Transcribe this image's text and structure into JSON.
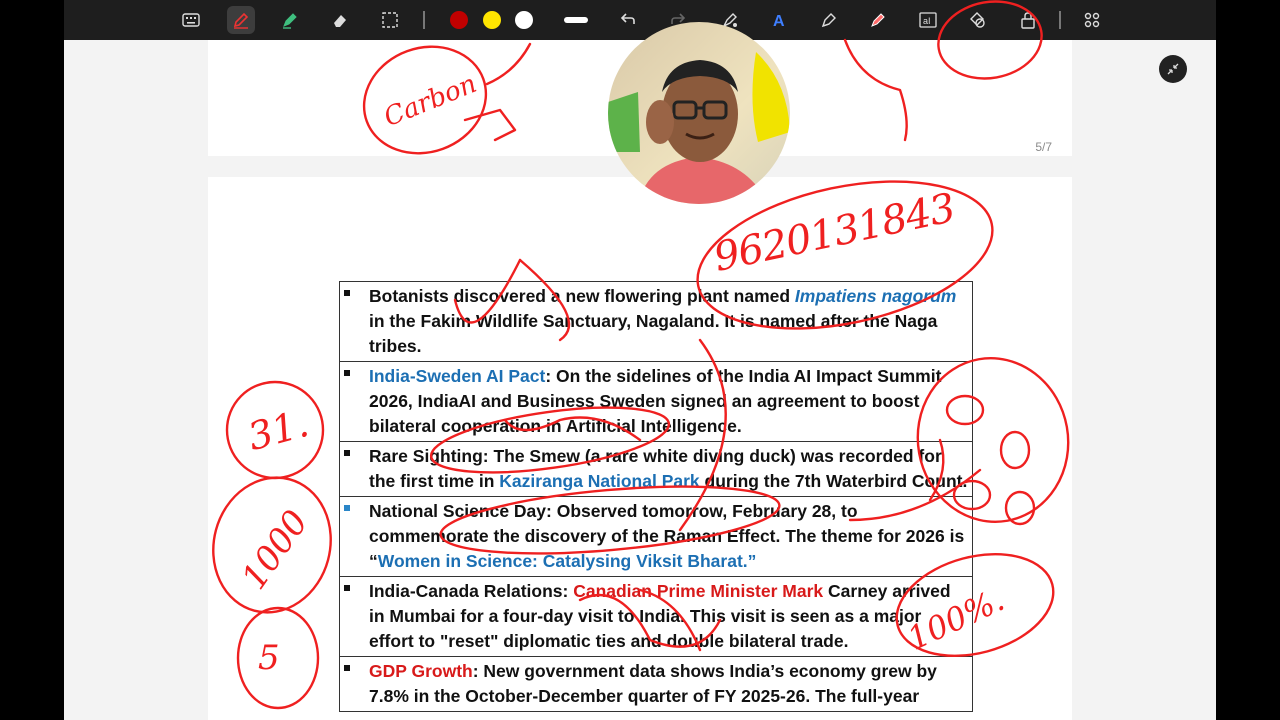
{
  "page_counter": "5/7",
  "toolbar": {
    "icons": [
      "keyboard-icon",
      "pen-icon",
      "highlighter-icon",
      "eraser-icon",
      "lasso-select-icon",
      "undo-icon",
      "redo-icon",
      "laser-pointer-icon",
      "text-icon",
      "shape-pen-icon",
      "red-pen-icon",
      "text-box-icon",
      "shapes-icon",
      "lock-icon",
      "grid-icon"
    ],
    "colors": {
      "red": "#c00000",
      "yellow": "#ffe500",
      "white": "#ffffff"
    }
  },
  "news": [
    {
      "parts": [
        {
          "t": "Botanists discovered a new flowering plant named ",
          "s": "n"
        },
        {
          "t": "Impatiens nagorum",
          "s": "bi"
        },
        {
          "t": " in the Fakim Wildlife Sanctuary, Nagaland. It is named after the Naga tribes.",
          "s": "n"
        }
      ]
    },
    {
      "parts": [
        {
          "t": "India-Sweden AI Pact",
          "s": "b"
        },
        {
          "t": ": On the sidelines of the India AI Impact Summit 2026, IndiaAI and Business Sweden signed an agreement to boost bilateral cooperation in Artificial Intelligence.",
          "s": "n"
        }
      ]
    },
    {
      "parts": [
        {
          "t": "Rare Sighting: The Smew (a rare white diving duck) was recorded for the first time in ",
          "s": "n"
        },
        {
          "t": "Kaziranga National Park",
          "s": "b"
        },
        {
          "t": " during the 7th Waterbird Count.",
          "s": "n"
        }
      ]
    },
    {
      "parts": [
        {
          "t": "National Science Day: Observed tomorrow, February 28, to commemorate the discovery of the Raman Effect. The theme for 2026 is “",
          "s": "n"
        },
        {
          "t": "Women in Science: Catalysing Viksit Bharat.”",
          "s": "b"
        }
      ]
    },
    {
      "parts": [
        {
          "t": " India-Canada Relations: ",
          "s": "n"
        },
        {
          "t": "Canadian Prime Minister Mark",
          "s": "r"
        },
        {
          "t": " Carney arrived in Mumbai for a four-day visit to India. This visit is seen as a major effort to \"reset\" diplomatic ties and double bilateral trade.",
          "s": "n"
        }
      ]
    },
    {
      "parts": [
        {
          "t": "GDP Growth",
          "s": "r"
        },
        {
          "t": ": New government data shows India’s economy grew by 7.8% in the October-December quarter of FY 2025-26. The full-year",
          "s": "n"
        }
      ]
    }
  ],
  "handwriting": {
    "top_left": "Carbon",
    "phone": "9620131843",
    "left_1": "31.",
    "left_2": "1000",
    "left_3": "5",
    "right_pct": "100%."
  }
}
